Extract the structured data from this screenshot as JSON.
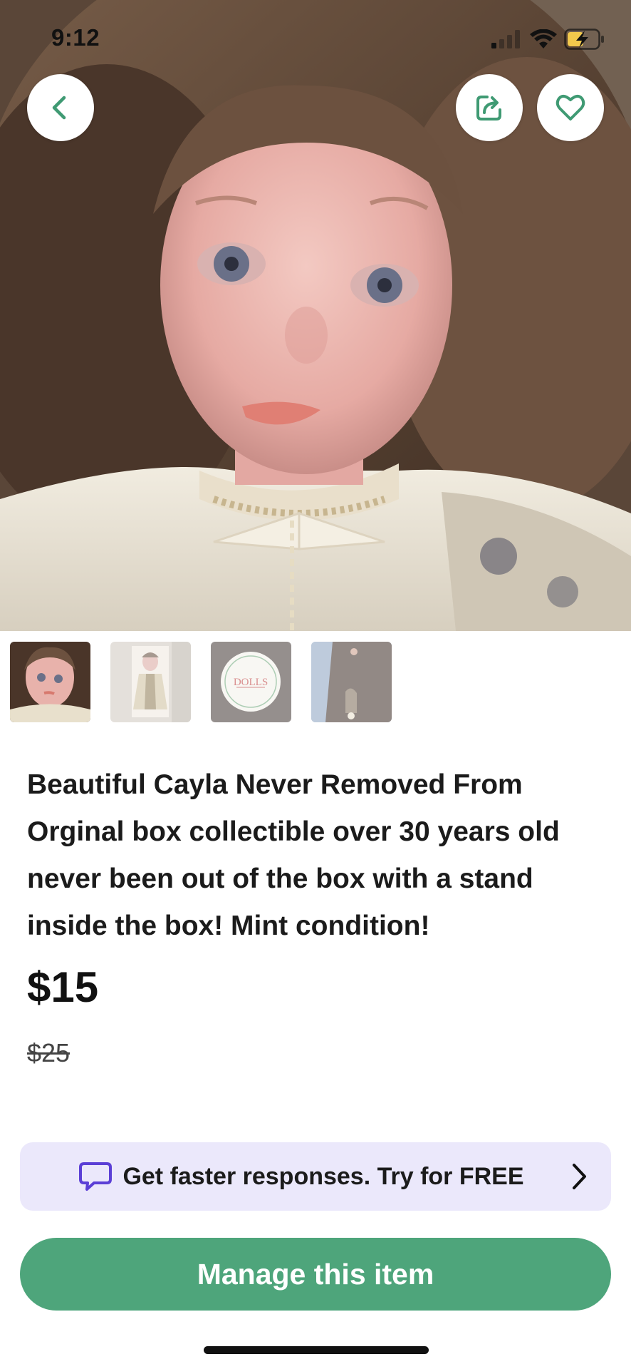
{
  "status_bar": {
    "time": "9:12"
  },
  "listing": {
    "description": "Beautiful Cayla Never Removed From Orginal box  collectible over 30 years old never been out of the box with a stand inside the box!  Mint condition!",
    "price": "$15",
    "original_price": "$25",
    "thumbnail_badge_text": "DOLLS"
  },
  "promo": {
    "text": "Get faster responses.  Try for FREE"
  },
  "actions": {
    "manage_label": "Manage this item"
  },
  "colors": {
    "accent_green": "#4ea57b",
    "promo_bg": "#ebe8fb",
    "promo_icon": "#5b3fd6"
  },
  "icons": [
    "back-icon",
    "share-icon",
    "heart-icon",
    "chat-bubble-icon",
    "chevron-right-icon",
    "wifi-icon",
    "battery-charging-icon",
    "signal-icon"
  ]
}
